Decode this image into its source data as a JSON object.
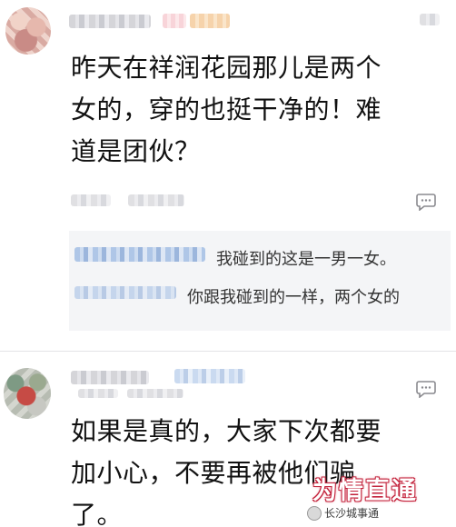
{
  "comments": [
    {
      "text": "昨天在祥润花园那儿是两个\n女的，穿的也挺干净的！难\n道是团伙？",
      "replies": [
        {
          "text": "我碰到的这是一男一女。"
        },
        {
          "text": "你跟我碰到的一样，两个女的"
        }
      ]
    },
    {
      "text": "如果是真的，大家下次都要\n加小心，不要再被他们骗\n了。"
    }
  ],
  "watermark": {
    "main": "为情直通",
    "sub": "长沙城事通"
  },
  "icons": {
    "reply": "reply-icon",
    "avatar_1": "avatar",
    "avatar_2": "avatar"
  },
  "colors": {
    "reply_bg": "#f4f5f7",
    "watermark_red": "#c2213a"
  }
}
